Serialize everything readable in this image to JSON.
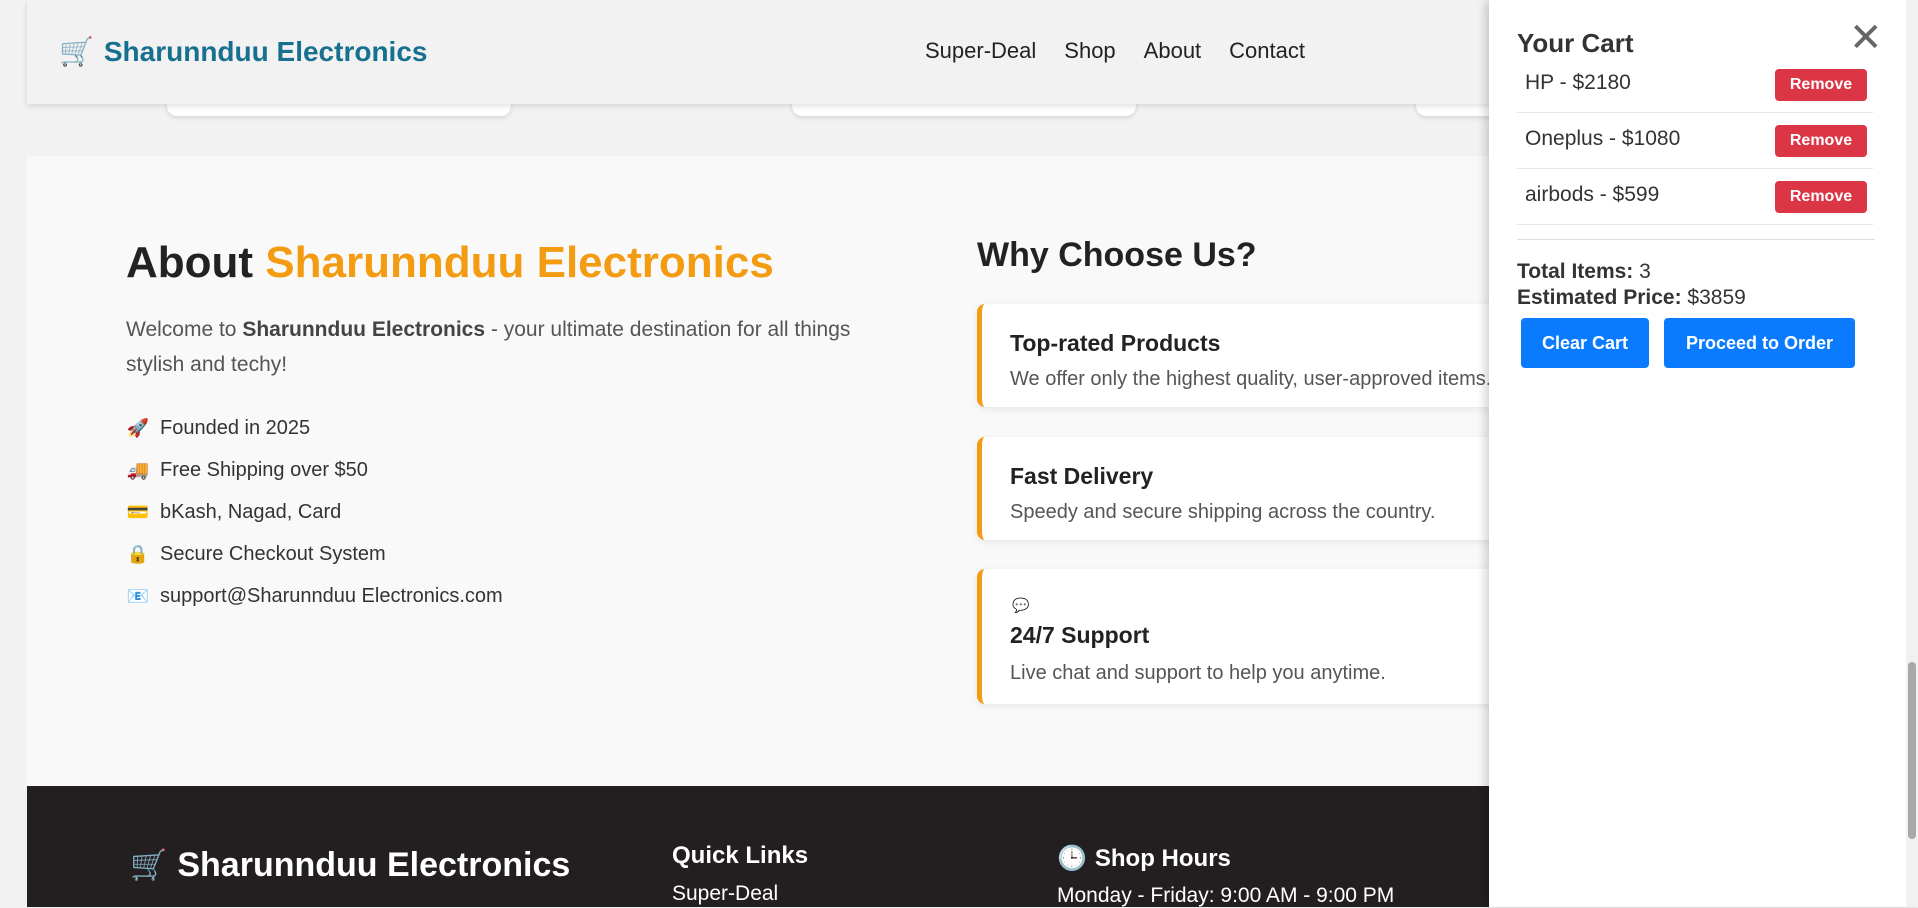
{
  "navbar": {
    "brand": "Sharunnduu Electronics",
    "links": [
      "Super-Deal",
      "Shop",
      "About",
      "Contact"
    ]
  },
  "about": {
    "title_prefix": "About",
    "title_accent": "Sharunnduu Electronics",
    "desc_prefix": "Welcome to",
    "desc_brand": "Sharunnduu Electronics",
    "desc_suffix": "- your ultimate destination for all things stylish and techy!",
    "features": [
      {
        "icon": "rocket-icon",
        "text": "Founded in 2025"
      },
      {
        "icon": "delivery-truck-icon",
        "text": "Free Shipping over $50"
      },
      {
        "icon": "credit-card-icon",
        "text": "bKash, Nagad, Card"
      },
      {
        "icon": "lock-icon",
        "text": "Secure Checkout System"
      },
      {
        "icon": "email-icon",
        "text": "support@Sharunnduu Electronics.com"
      }
    ]
  },
  "why": {
    "title": "Why Choose Us?",
    "cards": [
      {
        "title": "Top-rated Products",
        "text": "We offer only the highest quality, user-approved items."
      },
      {
        "title": "Fast Delivery",
        "text": "Speedy and secure shipping across the country."
      },
      {
        "title": "24/7 Support",
        "text": "Live chat and support to help you anytime.",
        "icon": "speech-bubble-icon"
      }
    ]
  },
  "footer": {
    "brand": "Sharunnduu Electronics",
    "quick_links_title": "Quick Links",
    "quick_links": [
      "Super-Deal"
    ],
    "hours_title": "Shop Hours",
    "hours": [
      "Monday - Friday: 9:00 AM - 9:00 PM"
    ]
  },
  "cart": {
    "title": "Your Cart",
    "close_symbol": "✕",
    "remove_label": "Remove",
    "items": [
      {
        "text": "HP - $2180"
      },
      {
        "text": "Oneplus - $1080"
      },
      {
        "text": "airbods - $599"
      }
    ],
    "total_items_label": "Total Items:",
    "total_items": "3",
    "estimated_price_label": "Estimated Price:",
    "estimated_price": "$3859",
    "clear_label": "Clear Cart",
    "order_label": "Proceed to Order"
  },
  "colors": {
    "brand_blue": "#17708f",
    "accent_orange": "#f39c12",
    "remove_red": "#dc3545",
    "button_blue": "#0a7bff",
    "footer_dark": "#231f20"
  }
}
